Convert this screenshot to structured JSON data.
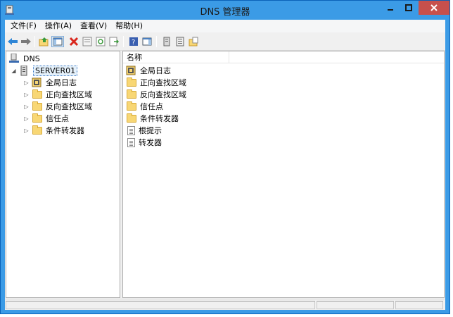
{
  "window": {
    "title": "DNS 管理器"
  },
  "menu": [
    "文件(F)",
    "操作(A)",
    "查看(V)",
    "帮助(H)"
  ],
  "toolbar": {
    "buttons": [
      "back-icon",
      "forward-icon",
      "up-folder-icon",
      "show-hide-tree-icon",
      "delete-icon",
      "properties-icon",
      "refresh-icon",
      "export-list-icon",
      "help-icon",
      "show-hide-action-pane-icon",
      "server-icon",
      "list-view-icon",
      "folder-new-icon"
    ]
  },
  "tree": {
    "root": "DNS",
    "server": "SERVER01",
    "children": [
      "全局日志",
      "正向查找区域",
      "反向查找区域",
      "信任点",
      "条件转发器"
    ]
  },
  "list": {
    "column_name": "名称",
    "items": [
      "全局日志",
      "正向查找区域",
      "反向查找区域",
      "信任点",
      "条件转发器",
      "根提示",
      "转发器"
    ]
  }
}
